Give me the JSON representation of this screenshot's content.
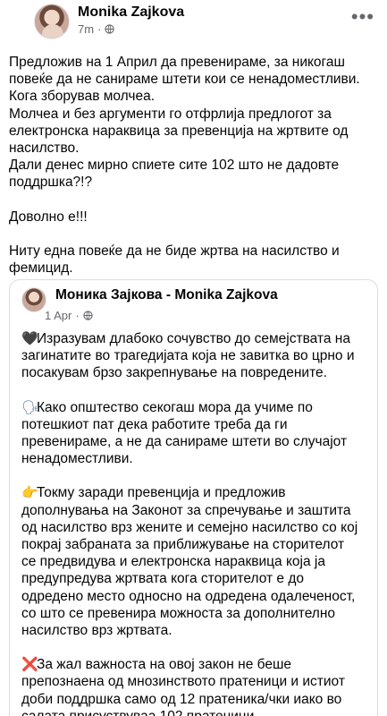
{
  "post": {
    "author": "Monika Zajkova",
    "time": "7m",
    "dot": "·",
    "more_icon": "ellipsis-icon",
    "privacy_icon": "globe-icon",
    "lines": [
      "Предложив на 1 Април да превенираме, за никогаш",
      "повеќе да не санираме штети кои се ненадоместливи.",
      "Кога зборував молчеа.",
      "Молчеа и без аргументи го отфрлија предлогот за",
      "електронска нараквица за превенција на жртвите од",
      "насилство.",
      "Дали денес мирно спиете сите 102 што не дадовте",
      "поддршка?!?",
      "",
      "Доволно е!!!",
      "",
      "Ниту една повеќе да не биде жртва на насилство и",
      "фемицид."
    ]
  },
  "shared": {
    "author": "Моника Зајкова - Monika Zajkova",
    "time": "1 Apr",
    "dot": "·",
    "privacy_icon": "globe-icon",
    "paragraphs": [
      {
        "emoji": "🖤",
        "emoji_name": "black-heart-icon",
        "lines": [
          "Изразувам длабоко сочувство до семејствата на",
          "загинатите во трагедијата која не завитка во црно и",
          "посакувам брзо закрепнување на повредените."
        ]
      },
      {
        "emoji": "🗣",
        "emoji_name": "speaking-head-icon",
        "lines": [
          "Како општество секогаш мора да учиме по",
          "потешкиот пат дека работите треба да ги",
          "превенираме, а не да санираме штети во случајот",
          "ненадоместливи."
        ]
      },
      {
        "emoji": "👉",
        "emoji_name": "pointing-hand-icon",
        "lines": [
          "Токму заради превенција и предложив",
          "дополнувања на Законот за спречување и заштита",
          "од насилство врз жените и семејно насилство со кој",
          "покрај забраната за приближување на сторителот",
          "се предвидува и електронска нараквица која ја",
          "предупредува жртвата кога сторителот е до",
          "одредено место односно на одредена одалеченост,",
          "со што се превенира можноста за дополнително",
          "насилство врз жртвата."
        ]
      },
      {
        "emoji": "❌",
        "emoji_name": "cross-mark-icon",
        "lines": [
          "За жал важноста на овој закон не беше",
          "препознаена од мнозинството пратеници и истиот",
          "доби поддршка само од 12 пратеника/чки иако во",
          "салата присуствуваа 102 пратеници."
        ]
      }
    ]
  }
}
